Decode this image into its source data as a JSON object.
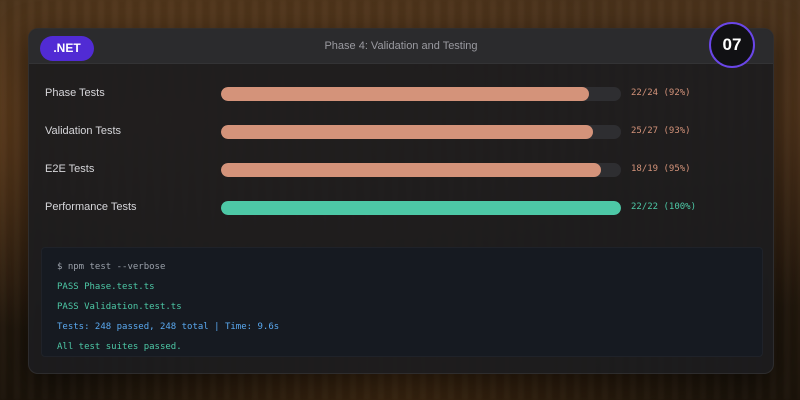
{
  "header": {
    "badge": ".NET",
    "title": "Phase 4: Validation and Testing",
    "step": "07"
  },
  "colors": {
    "accent": "#512bd4",
    "progress": "#d4937a",
    "complete": "#4dc8a6",
    "terminal_bg": "#161a21"
  },
  "progress_rows": [
    {
      "label": "Phase Tests",
      "value": "22/24 (92%)",
      "fraction": 0.92,
      "status": "partial"
    },
    {
      "label": "Validation Tests",
      "value": "25/27 (93%)",
      "fraction": 0.93,
      "status": "partial"
    },
    {
      "label": "E2E Tests",
      "value": "18/19 (95%)",
      "fraction": 0.95,
      "status": "partial"
    },
    {
      "label": "Performance Tests",
      "value": "22/22 (100%)",
      "fraction": 1.0,
      "status": "complete"
    }
  ],
  "terminal": {
    "lines": [
      {
        "text": "$ npm test --verbose",
        "color": "#9aa0aa"
      },
      {
        "text": "PASS Phase.test.ts",
        "color": "#4dc8a6"
      },
      {
        "text": "PASS Validation.test.ts",
        "color": "#4dc8a6"
      },
      {
        "text": "Tests: 248 passed, 248 total | Time: 9.6s",
        "color": "#5aa9f0"
      },
      {
        "text": "All test suites passed.",
        "color": "#4dc8a6"
      }
    ]
  }
}
